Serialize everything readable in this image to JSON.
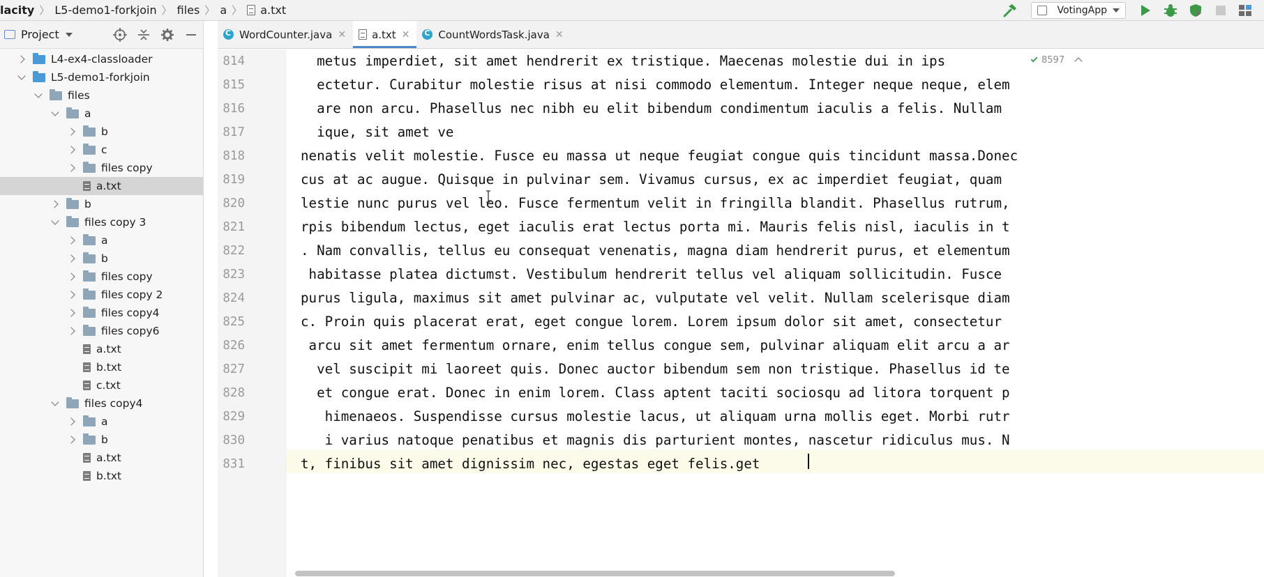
{
  "breadcrumb": {
    "items": [
      "lacity",
      "L5-demo1-forkjoin",
      "files",
      "a",
      "a.txt"
    ]
  },
  "toolbar": {
    "run_config": "VotingApp",
    "icons": [
      "build-hammer-icon",
      "run-icon",
      "debug-icon",
      "coverage-icon",
      "stop-icon",
      "project-structure-icon"
    ]
  },
  "project_panel": {
    "title": "Project",
    "tools": [
      "locate-icon",
      "collapse-all-icon",
      "settings-icon",
      "hide-icon"
    ],
    "tree": [
      {
        "label": "L4-ex4-classloader",
        "type": "module",
        "state": "collapsed"
      },
      {
        "label": "L5-demo1-forkjoin",
        "type": "module",
        "state": "expanded"
      },
      {
        "label": "files",
        "type": "folder",
        "state": "expanded"
      },
      {
        "label": "a",
        "type": "folder",
        "state": "expanded"
      },
      {
        "label": "b",
        "type": "folder",
        "state": "collapsed"
      },
      {
        "label": "c",
        "type": "folder",
        "state": "collapsed"
      },
      {
        "label": "files copy",
        "type": "folder",
        "state": "collapsed"
      },
      {
        "label": "a.txt",
        "type": "file",
        "state": "selected"
      },
      {
        "label": "b",
        "type": "folder",
        "state": "collapsed"
      },
      {
        "label": "files copy 3",
        "type": "folder",
        "state": "expanded"
      },
      {
        "label": "a",
        "type": "folder",
        "state": "collapsed"
      },
      {
        "label": "b",
        "type": "folder",
        "state": "collapsed"
      },
      {
        "label": "files copy",
        "type": "folder",
        "state": "collapsed"
      },
      {
        "label": "files copy 2",
        "type": "folder",
        "state": "collapsed"
      },
      {
        "label": "files copy4",
        "type": "folder",
        "state": "collapsed"
      },
      {
        "label": "files copy6",
        "type": "folder",
        "state": "collapsed"
      },
      {
        "label": "a.txt",
        "type": "file",
        "state": "none"
      },
      {
        "label": "b.txt",
        "type": "file",
        "state": "none"
      },
      {
        "label": "c.txt",
        "type": "file",
        "state": "none"
      },
      {
        "label": "files copy4",
        "type": "folder",
        "state": "expanded"
      },
      {
        "label": "a",
        "type": "folder",
        "state": "collapsed"
      },
      {
        "label": "b",
        "type": "folder",
        "state": "collapsed"
      },
      {
        "label": "a.txt",
        "type": "file",
        "state": "none"
      },
      {
        "label": "b.txt",
        "type": "file",
        "state": "none"
      }
    ]
  },
  "tabs": [
    {
      "label": "WordCounter.java",
      "kind": "java",
      "active": false
    },
    {
      "label": "a.txt",
      "kind": "text",
      "active": true
    },
    {
      "label": "CountWordsTask.java",
      "kind": "java",
      "active": false
    }
  ],
  "editor": {
    "inspection_count": "8597",
    "lines": [
      {
        "num": "814",
        "text": "  metus imperdiet, sit amet hendrerit ex tristique. Maecenas molestie dui in ips"
      },
      {
        "num": "815",
        "text": "  ectetur. Curabitur molestie risus at nisi commodo elementum. Integer neque neque, elem"
      },
      {
        "num": "816",
        "text": "  are non arcu. Phasellus nec nibh eu elit bibendum condimentum iaculis a felis. Nullam"
      },
      {
        "num": "817",
        "text": "  ique, sit amet ve"
      },
      {
        "num": "818",
        "text": "nenatis velit molestie. Fusce eu massa ut neque feugiat congue quis tincidunt massa.Donec"
      },
      {
        "num": "819",
        "text": "cus at ac augue. Quisque in pulvinar sem. Vivamus cursus, ex ac imperdiet feugiat, quam"
      },
      {
        "num": "820",
        "text": "lestie nunc purus vel leo. Fusce fermentum velit in fringilla blandit. Phasellus rutrum,"
      },
      {
        "num": "821",
        "text": "rpis bibendum lectus, eget iaculis erat lectus porta mi. Mauris felis nisl, iaculis in t"
      },
      {
        "num": "822",
        "text": ". Nam convallis, tellus eu consequat venenatis, magna diam hendrerit purus, et elementum"
      },
      {
        "num": "823",
        "text": " habitasse platea dictumst. Vestibulum hendrerit tellus vel aliquam sollicitudin. Fusce"
      },
      {
        "num": "824",
        "text": "purus ligula, maximus sit amet pulvinar ac, vulputate vel velit. Nullam scelerisque diam"
      },
      {
        "num": "825",
        "text": "c. Proin quis placerat erat, eget congue lorem. Lorem ipsum dolor sit amet, consectetur"
      },
      {
        "num": "826",
        "text": " arcu sit amet fermentum ornare, enim tellus congue sem, pulvinar aliquam elit arcu a ar"
      },
      {
        "num": "827",
        "text": "  vel suscipit mi laoreet quis. Donec auctor bibendum sem non tristique. Phasellus id te"
      },
      {
        "num": "828",
        "text": "  et congue erat. Donec in enim lorem. Class aptent taciti sociosqu ad litora torquent p"
      },
      {
        "num": "829",
        "text": "   himenaeos. Suspendisse cursus molestie lacus, ut aliquam urna mollis eget. Morbi rutr"
      },
      {
        "num": "830",
        "text": "   i varius natoque penatibus et magnis dis parturient montes, nascetur ridiculus mus. N"
      },
      {
        "num": "831",
        "text": "t, finibus sit amet dignissim nec, egestas eget felis.get"
      }
    ]
  },
  "colors": {
    "accent": "#4a88c7",
    "module_folder": "#4a9ad8",
    "folder": "#8fa6b9",
    "run_green": "#3c9a46",
    "current_line": "#fcfbe9"
  }
}
